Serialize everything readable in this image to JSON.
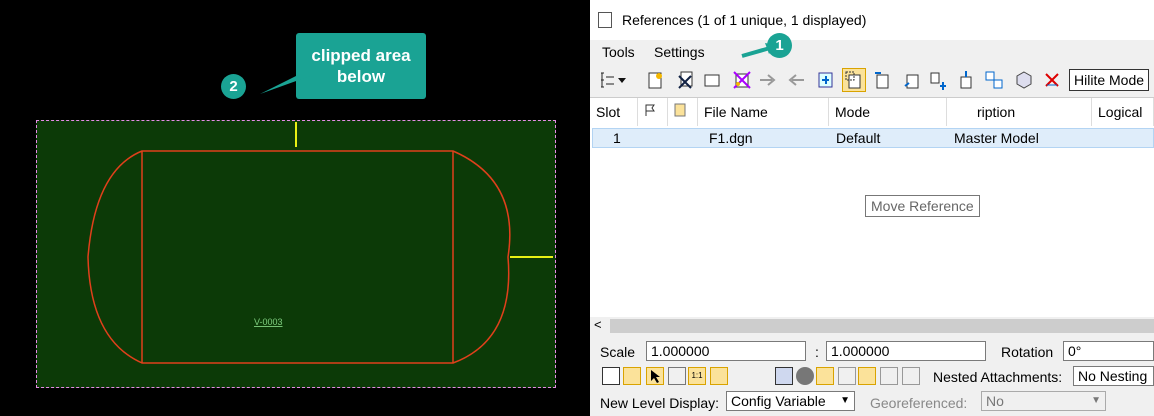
{
  "callout": {
    "line1": "clipped  area",
    "line2": "below",
    "badge2": "2",
    "badge1": "1"
  },
  "drawing": {
    "label": "V-0003",
    "clip_color": "#e58be5",
    "fill": "#0c3a07",
    "outline": "#e0401b",
    "marker": "#e7f014"
  },
  "window": {
    "title": "References (1 of 1 unique, 1 displayed)"
  },
  "menu": {
    "tools": "Tools",
    "settings": "Settings"
  },
  "toolbar": {
    "hilite": "Hilite Mode"
  },
  "tooltip": "Move Reference",
  "table": {
    "headers": [
      "Slot",
      "",
      "",
      "File Name",
      "Mode",
      "ription",
      "Logical"
    ],
    "rows": [
      {
        "slot": "1",
        "file": "F1.dgn",
        "model": "Default",
        "desc": "Master Model",
        "logical": ""
      }
    ]
  },
  "bottom": {
    "scale_label": "Scale",
    "scale1": "1.000000",
    "colon": ":",
    "scale2": "1.000000",
    "rotation_label": "Rotation",
    "rotation": "0°",
    "nested_label": "Nested Attachments:",
    "nested_value": "No Nesting",
    "newlevel_label": "New Level Display:",
    "newlevel_value": "Config Variable",
    "georef_label": "Georeferenced:",
    "georef_value": "No"
  },
  "scroll_left": "<"
}
